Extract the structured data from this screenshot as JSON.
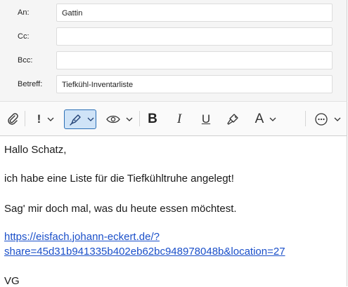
{
  "recipients": {
    "to_label": "An:",
    "to_value": "Gattin",
    "cc_label": "Cc:",
    "cc_value": "",
    "bcc_label": "Bcc:",
    "bcc_value": "",
    "subject_label": "Betreff:",
    "subject_value": "Tiefkühl-Inventarliste"
  },
  "toolbar": {
    "bold_glyph": "B",
    "italic_glyph": "I",
    "underline_glyph": "U",
    "font_color_glyph": "A",
    "importance_glyph": "!",
    "active_tool": "signature-pen",
    "active_color": "#cfe3f7"
  },
  "message": {
    "greeting": "Hallo Schatz,",
    "line1": "ich habe eine Liste für die Tiefkühltruhe angelegt!",
    "line2": "Sag' mir doch mal, was du heute essen möchtest.",
    "link_line1": "https://eisfach.johann-eckert.de/?",
    "link_line2": "share=45d31b941335b402eb62bc948978048b&location=27",
    "signoff": "VG"
  }
}
